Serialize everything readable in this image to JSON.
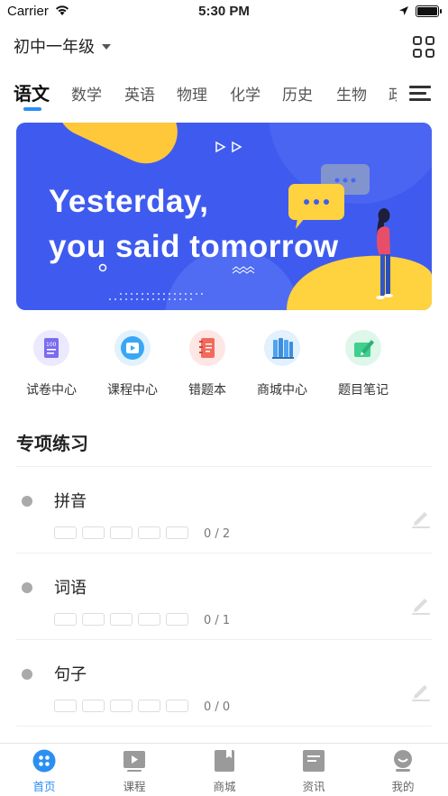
{
  "status_bar": {
    "carrier": "Carrier",
    "time": "5:30 PM"
  },
  "header": {
    "grade": "初中一年级"
  },
  "subject_tabs": [
    {
      "label": "语文",
      "active": true
    },
    {
      "label": "数学",
      "active": false
    },
    {
      "label": "英语",
      "active": false
    },
    {
      "label": "物理",
      "active": false
    },
    {
      "label": "化学",
      "active": false
    },
    {
      "label": "历史",
      "active": false
    },
    {
      "label": "生物",
      "active": false
    },
    {
      "label": "政治",
      "active": false
    }
  ],
  "banner": {
    "line1": "Yesterday,",
    "line2": "you said tomorrow"
  },
  "shortcuts": [
    {
      "label": "试卷中心",
      "icon": "exam-paper-icon",
      "color": "#7b6cf0"
    },
    {
      "label": "课程中心",
      "icon": "play-video-icon",
      "color": "#39a7f5"
    },
    {
      "label": "错题本",
      "icon": "notebook-icon",
      "color": "#f26a5c"
    },
    {
      "label": "商城中心",
      "icon": "books-icon",
      "color": "#4fa3f0"
    },
    {
      "label": "题目笔记",
      "icon": "pencil-note-icon",
      "color": "#3fcf8e"
    }
  ],
  "section": {
    "title": "专项练习"
  },
  "practice_items": [
    {
      "name": "拼音",
      "progress": "0 / 2",
      "done": 0,
      "total": 2
    },
    {
      "name": "词语",
      "progress": "0 / 1",
      "done": 0,
      "total": 1
    },
    {
      "name": "句子",
      "progress": "0 / 0",
      "done": 0,
      "total": 0
    }
  ],
  "tabbar": [
    {
      "label": "首页",
      "icon": "home-icon",
      "active": true
    },
    {
      "label": "课程",
      "icon": "course-play-icon",
      "active": false
    },
    {
      "label": "商城",
      "icon": "store-book-icon",
      "active": false
    },
    {
      "label": "资讯",
      "icon": "news-icon",
      "active": false
    },
    {
      "label": "我的",
      "icon": "profile-icon",
      "active": false
    }
  ],
  "colors": {
    "accent": "#2b8ff2",
    "banner_bg": "#3f5bef",
    "banner_yellow": "#ffd23f",
    "inactive_icon": "#9a9a9a"
  }
}
